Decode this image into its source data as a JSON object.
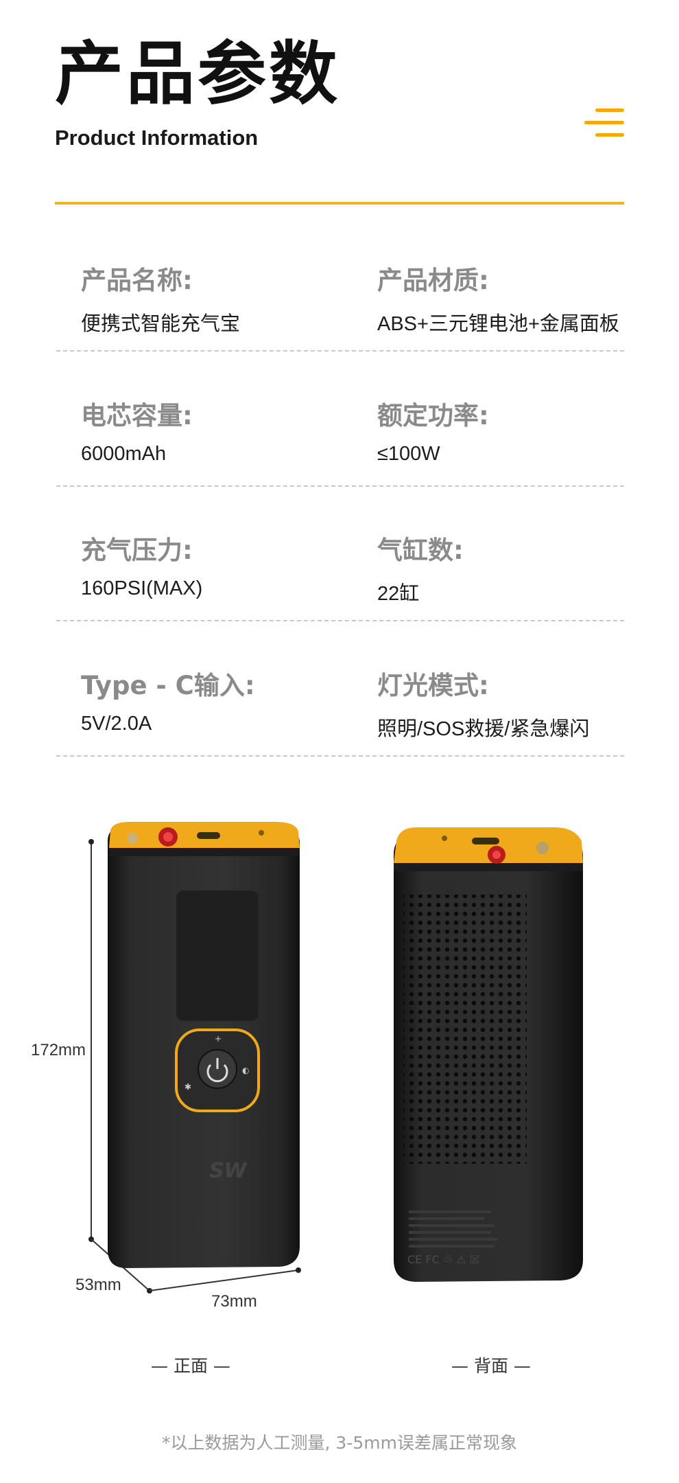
{
  "header": {
    "title_cn": "产品参数",
    "title_en": "Product Information",
    "accent_color": "#F2A900"
  },
  "specs": [
    {
      "label": "产品名称:",
      "value": "便携式智能充气宝"
    },
    {
      "label": "产品材质:",
      "value": "ABS+三元锂电池+金属面板"
    },
    {
      "label": "电芯容量:",
      "value": "6000mAh"
    },
    {
      "label": "额定功率:",
      "value": "≤100W"
    },
    {
      "label": "充气压力:",
      "value": "160PSI(MAX)"
    },
    {
      "label": "气缸数:",
      "value": "22缸"
    },
    {
      "label": "Type - C输入:",
      "value": "5V/2.0A"
    },
    {
      "label": "灯光模式:",
      "value": "照明/SOS救援/紧急爆闪"
    }
  ],
  "dimensions": {
    "height": "172mm",
    "depth": "53mm",
    "width": "73mm"
  },
  "views": {
    "front": "— 正面 —",
    "back": "— 背面 —"
  },
  "device": {
    "logo": "SW",
    "back_cert_marks": "CE FC ♲ ⚠ ☒"
  },
  "footnote": "*以上数据为人工测量, 3-5mm误差属正常现象"
}
